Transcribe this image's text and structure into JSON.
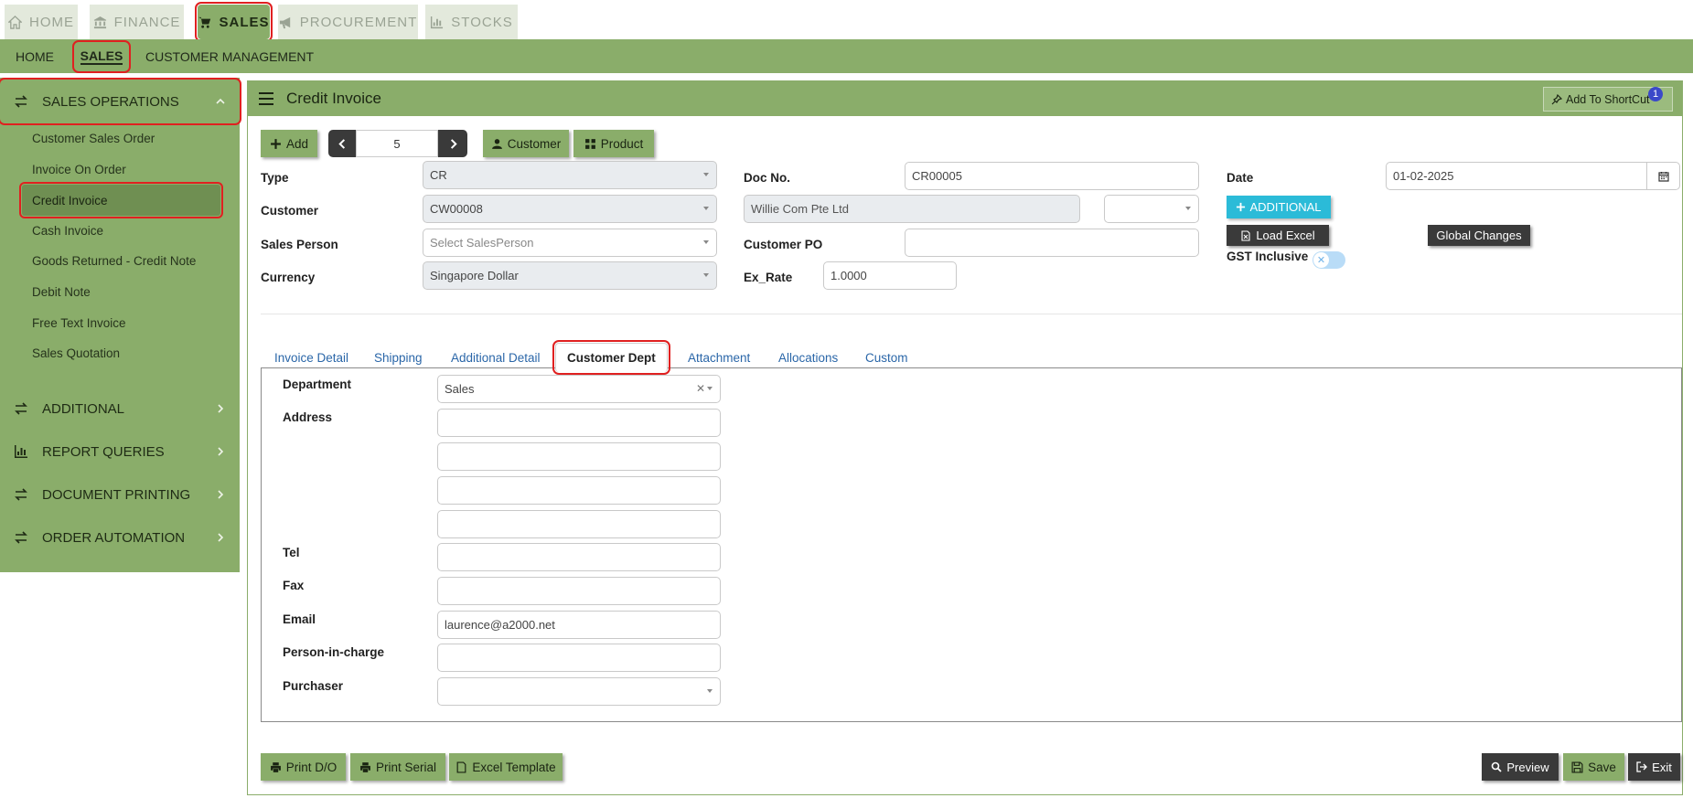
{
  "top_tabs": [
    {
      "label": "HOME",
      "icon": "home-icon"
    },
    {
      "label": "FINANCE",
      "icon": "bank-icon"
    },
    {
      "label": "SALES",
      "icon": "cart-icon",
      "active": true
    },
    {
      "label": "PROCUREMENT",
      "icon": "megaphone-icon"
    },
    {
      "label": "STOCKS",
      "icon": "bar-chart-icon"
    }
  ],
  "subnav": [
    {
      "label": "HOME"
    },
    {
      "label": "SALES",
      "active": true
    },
    {
      "label": "CUSTOMER MANAGEMENT"
    }
  ],
  "sidebar": {
    "sections": [
      {
        "label": "SALES OPERATIONS",
        "expanded": true
      },
      {
        "label": "ADDITIONAL"
      },
      {
        "label": "REPORT QUERIES"
      },
      {
        "label": "DOCUMENT PRINTING"
      },
      {
        "label": "ORDER AUTOMATION"
      }
    ],
    "items": [
      {
        "label": "Customer Sales Order"
      },
      {
        "label": "Invoice On Order"
      },
      {
        "label": "Credit Invoice",
        "active": true
      },
      {
        "label": "Cash Invoice"
      },
      {
        "label": "Goods Returned - Credit Note"
      },
      {
        "label": "Debit Note"
      },
      {
        "label": "Free Text Invoice"
      },
      {
        "label": "Sales Quotation"
      }
    ]
  },
  "page": {
    "title": "Credit Invoice",
    "shortcut_label": "Add To ShortCut",
    "shortcut_badge": "1"
  },
  "toolbar": {
    "add_label": "Add",
    "record_number": "5",
    "customer_label": "Customer",
    "product_label": "Product"
  },
  "form": {
    "type_label": "Type",
    "type_value": "CR",
    "customer_label": "Customer",
    "customer_value": "CW00008",
    "sales_person_label": "Sales Person",
    "sales_person_placeholder": "Select SalesPerson",
    "currency_label": "Currency",
    "currency_value": "Singapore Dollar",
    "doc_no_label": "Doc No.",
    "doc_no_value": "CR00005",
    "customer_name_value": "Willie Com Pte Ltd",
    "customer_po_label": "Customer PO",
    "customer_po_value": "",
    "ex_rate_label": "Ex_Rate",
    "ex_rate_value": "1.0000",
    "date_label": "Date",
    "date_value": "01-02-2025",
    "additional_label": "ADDITIONAL",
    "load_excel_label": "Load Excel",
    "global_changes_label": "Global Changes",
    "gst_inclusive_label": "GST Inclusive",
    "gst_inclusive_on": false
  },
  "tabs": [
    {
      "label": "Invoice Detail"
    },
    {
      "label": "Shipping"
    },
    {
      "label": "Additional Detail"
    },
    {
      "label": "Customer Dept",
      "active": true
    },
    {
      "label": "Attachment"
    },
    {
      "label": "Allocations"
    },
    {
      "label": "Custom"
    }
  ],
  "dept": {
    "department_label": "Department",
    "department_value": "Sales",
    "address_label": "Address",
    "address_lines": [
      "",
      "",
      "",
      ""
    ],
    "tel_label": "Tel",
    "tel_value": "",
    "fax_label": "Fax",
    "fax_value": "",
    "email_label": "Email",
    "email_value": "laurence@a2000.net",
    "pic_label": "Person-in-charge",
    "pic_value": "",
    "purchaser_label": "Purchaser",
    "purchaser_value": ""
  },
  "footer": {
    "print_do_label": "Print D/O",
    "print_serial_label": "Print Serial",
    "excel_template_label": "Excel Template",
    "preview_label": "Preview",
    "save_label": "Save",
    "exit_label": "Exit"
  },
  "colors": {
    "brand_green": "#8aad6a",
    "sidebar_active": "#6f8f52",
    "highlight_red": "#e02020",
    "additional_cyan": "#2bbbd8",
    "dark_button": "#3a3a3a"
  }
}
